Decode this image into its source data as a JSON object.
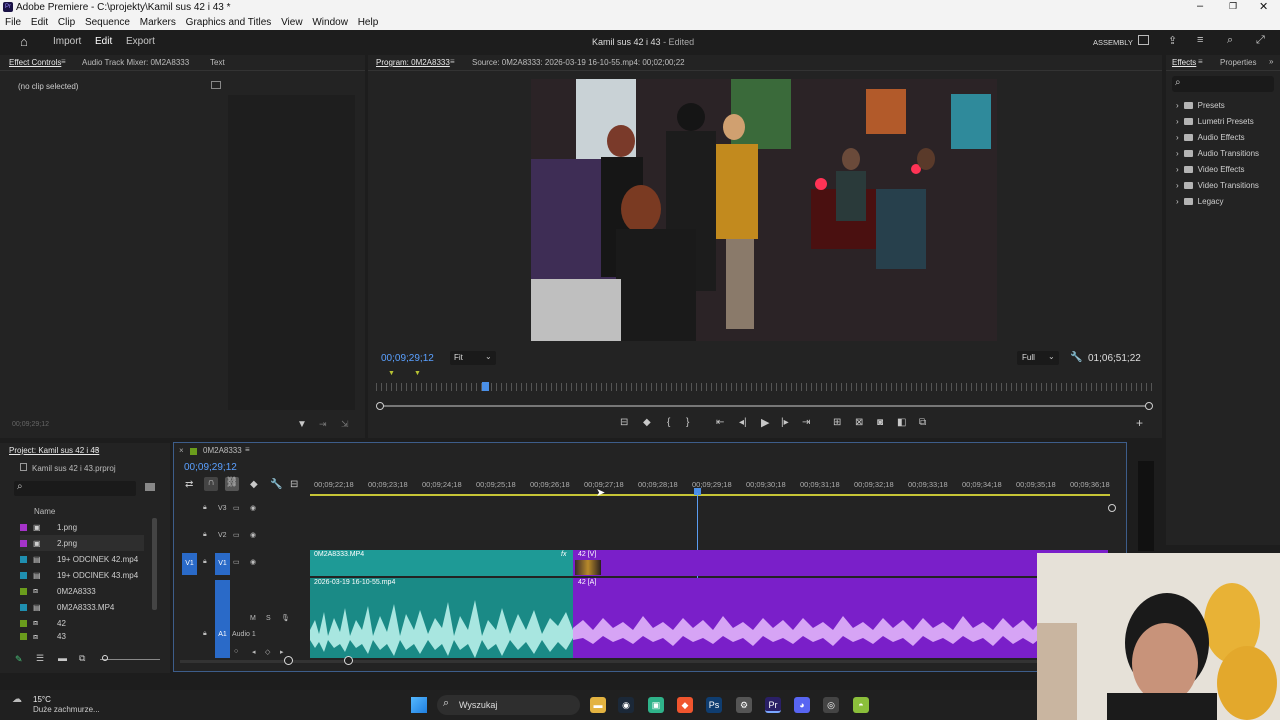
{
  "titlebar": {
    "title": "Adobe Premiere - C:\\projekty\\Kamil sus 42 i 43 *",
    "app_icon": "Pr"
  },
  "menu": [
    "File",
    "Edit",
    "Clip",
    "Sequence",
    "Markers",
    "Graphics and Titles",
    "View",
    "Window",
    "Help"
  ],
  "header": {
    "nav": [
      "Import",
      "Edit",
      "Export"
    ],
    "project_title": "Kamil sus 42 i 43",
    "status": "- Edited",
    "workspace": "ASSEMBLY"
  },
  "source_panel": {
    "tabs": [
      "Effect Controls",
      "Audio Track Mixer: 0M2A8333",
      "Text"
    ],
    "no_clip": "(no clip selected)",
    "timecode": "00;09;29;12"
  },
  "program_monitor": {
    "tab": "Program: 0M2A8333",
    "source_info": "Source: 0M2A8333: 2026-03-19 16-10-55.mp4: 00;02;00;22",
    "timecode": "00;09;29;12",
    "fit": "Fit",
    "resolution": "Full",
    "duration": "01;06;51;22"
  },
  "effects_panel": {
    "tabs": [
      "Effects",
      "Properties"
    ],
    "items": [
      "Presets",
      "Lumetri Presets",
      "Audio Effects",
      "Audio Transitions",
      "Video Effects",
      "Video Transitions",
      "Legacy"
    ]
  },
  "project_panel": {
    "title": "Project: Kamil sus 42 i 43",
    "file": "Kamil sus 42 i 43.prproj",
    "column": "Name",
    "items": [
      {
        "name": "1.png",
        "color": "#a533c9"
      },
      {
        "name": "2.png",
        "color": "#a533c9"
      },
      {
        "name": "19+  ODCINEK 42.mp4",
        "color": "#1f8fb0"
      },
      {
        "name": "19+  ODCINEK 43.mp4",
        "color": "#1f8fb0"
      },
      {
        "name": "0M2A8333",
        "color": "#6a9c1c"
      },
      {
        "name": "0M2A8333.MP4",
        "color": "#1f8fb0"
      },
      {
        "name": "42",
        "color": "#6a9c1c"
      },
      {
        "name": "43",
        "color": "#6a9c1c"
      }
    ]
  },
  "timeline": {
    "sequence": "0M2A8333",
    "timecode": "00;09;29;12",
    "ruler": [
      "00;09;22;18",
      "00;09;23;18",
      "00;09;24;18",
      "00;09;25;18",
      "00;09;26;18",
      "00;09;27;18",
      "00;09;28;18",
      "00;09;29;18",
      "00;09;30;18",
      "00;09;31;18",
      "00;09;32;18",
      "00;09;33;18",
      "00;09;34;18",
      "00;09;35;18",
      "00;09;36;18"
    ],
    "tracks": {
      "v3": "V3",
      "v2": "V2",
      "v1": "V1",
      "a1": "A1",
      "audio1": "Audio 1"
    },
    "clips": {
      "v1a": "0M2A8333.MP4",
      "v1b": "42 [V]",
      "a1a": "2026-03-19 16-10-55.mp4",
      "a1b": "42 [A]",
      "fx": "fx"
    }
  },
  "taskbar": {
    "temp": "15°C",
    "weather": "Duże zachmurze...",
    "search": "Wyszukaj"
  },
  "colors": {
    "accent": "#4a8fe7",
    "teal_clip": "#1e9a96",
    "purple_clip": "#7a1fc9"
  }
}
